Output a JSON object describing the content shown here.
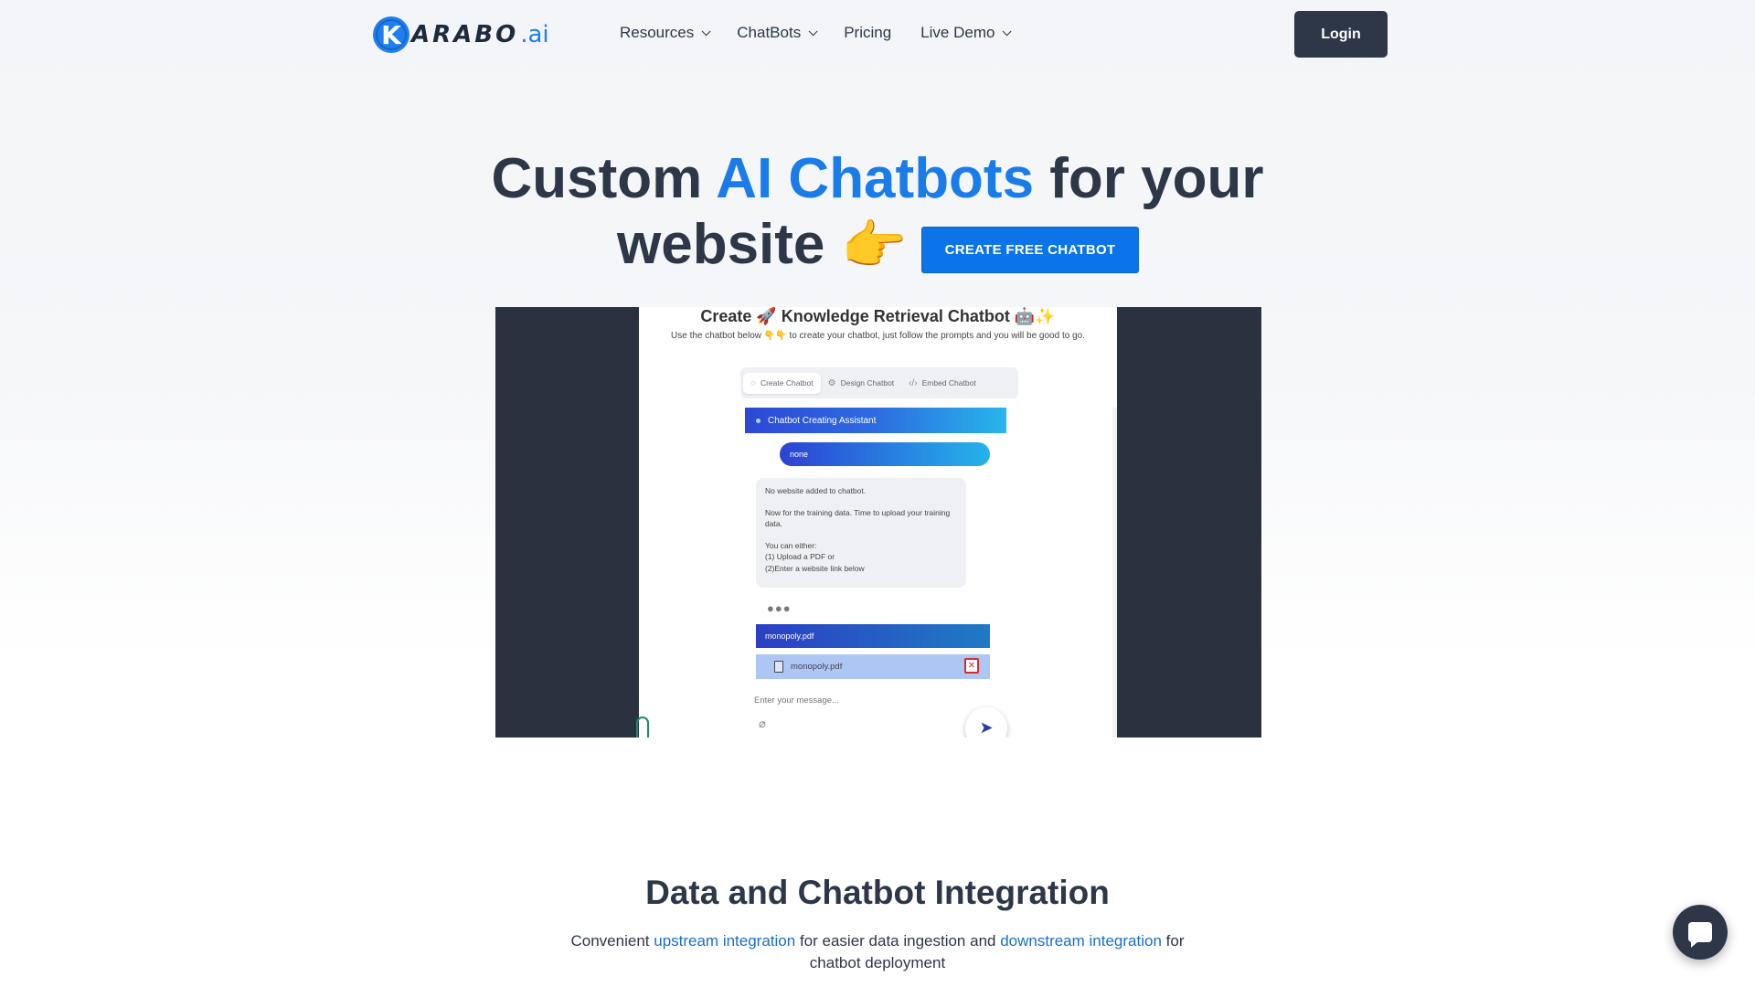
{
  "header": {
    "logo_mark": "K",
    "logo_word": "ARABO",
    "logo_suffix": ".ai",
    "nav": [
      {
        "label": "Resources",
        "has_dropdown": true
      },
      {
        "label": "ChatBots",
        "has_dropdown": true
      },
      {
        "label": "Pricing",
        "has_dropdown": false
      },
      {
        "label": "Live Demo",
        "has_dropdown": true
      }
    ],
    "login_label": "Login"
  },
  "hero": {
    "title_part1": "Custom ",
    "title_accent": "AI Chatbots",
    "title_part2": " for your",
    "title_line2": "website",
    "hand_emoji": "👉",
    "cta_label": "CREATE FREE CHATBOT"
  },
  "demo": {
    "title": "Create 🚀 Knowledge Retrieval Chatbot 🤖✨",
    "subtitle": "Use the chatbot below 👇👇 to create your chatbot, just follow the prompts and you will be good to go.",
    "tabs": [
      {
        "label": "Create Chatbot",
        "icon": "chat-icon"
      },
      {
        "label": "Design Chatbot",
        "icon": "gear-icon"
      },
      {
        "label": "Embed Chatbot",
        "icon": "code-icon"
      }
    ],
    "assistant_label": "Chatbot Creating Assistant",
    "user_reply": "none",
    "bot_message": {
      "line1": "No website added to chatbot.",
      "line2": "Now for the training data. Time to upload your training data.",
      "line3a": "You can either:",
      "line3b": "(1) Upload a PDF or",
      "line3c": "(2)Enter a website link below"
    },
    "typing_indicator": "●●●",
    "file_bar_label": "monopoly.pdf",
    "file_chip_label": "monopoly.pdf",
    "input_placeholder": "Enter your message..."
  },
  "integration": {
    "title": "Data and Chatbot Integration",
    "desc_pre": "Convenient ",
    "desc_link1": "upstream integration",
    "desc_mid": " for easier data ingestion and ",
    "desc_link2": "downstream integration",
    "desc_post": " for chatbot deployment"
  },
  "colors": {
    "accent": "#1a7ce8",
    "dark": "#2d3748",
    "cta": "#0b74e8"
  }
}
